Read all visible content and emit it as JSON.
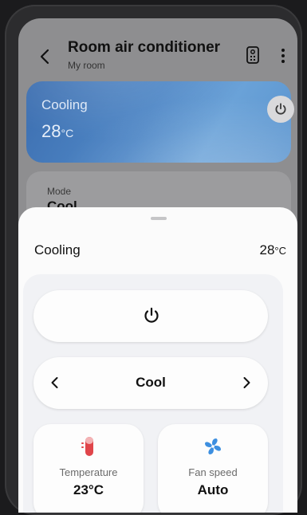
{
  "header": {
    "title": "Room air conditioner",
    "subtitle": "My room"
  },
  "status_card": {
    "state_label": "Cooling",
    "temperature": "28",
    "temperature_unit": "°C"
  },
  "mode_card": {
    "label": "Mode",
    "value": "Cool"
  },
  "sheet": {
    "title": "Cooling",
    "temperature": "28",
    "temperature_unit": "°C",
    "mode_value": "Cool",
    "tiles": [
      {
        "label": "Temperature",
        "value": "23°C",
        "icon": "thermometer-icon"
      },
      {
        "label": "Fan speed",
        "value": "Auto",
        "icon": "fan-icon"
      }
    ]
  },
  "colors": {
    "accent_blue": "#4f87c6",
    "thermometer_red": "#e0454a",
    "fan_blue": "#3d8fe0"
  }
}
